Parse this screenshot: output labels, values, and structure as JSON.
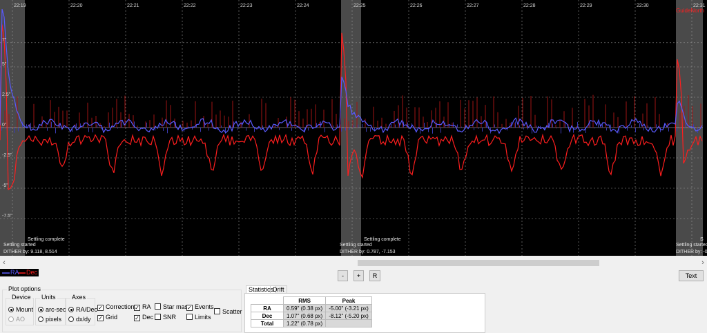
{
  "graph": {
    "time_labels": [
      "22:19",
      "22:20",
      "22:21",
      "22:22",
      "22:23",
      "22:24",
      "22:25",
      "22:26",
      "22:27",
      "22:28",
      "22:29",
      "22:30",
      "22:31"
    ],
    "y_labels": [
      "7\"",
      "5\"",
      "2.5\"",
      "0\"",
      "-2.5\"",
      "-5\"",
      "-7.5\""
    ],
    "corner_label": "GuideNorth",
    "events": [
      {
        "settling_started": "Settling started",
        "settling_complete": "Settling complete",
        "dither": "DITHER by: 9.118, 8.514"
      },
      {
        "settling_started": "Settling started",
        "settling_complete": "Settling complete",
        "dither": "DITHER by: 0.787, -7.153"
      },
      {
        "settling_started": "Settling started",
        "settling_complete": "S",
        "dither": "DITHER by: -0"
      }
    ],
    "colors": {
      "ra": "#5a5aff",
      "dec": "#ff1e1e",
      "corrections_ra": "#3c3cb4",
      "corrections_dec": "#a01414",
      "grid": "#9a9a9a",
      "settling_band": "#4a4a4a"
    }
  },
  "legend": {
    "ra": "RA",
    "dec": "Dec"
  },
  "buttons": {
    "minus": "-",
    "plus": "+",
    "reset": "R",
    "text": "Text"
  },
  "plot_options": {
    "title": "Plot options",
    "device": {
      "caption": "Device",
      "mount": "Mount",
      "ao": "AO",
      "selected": "Mount"
    },
    "units": {
      "caption": "Units",
      "arcsec": "arc-sec",
      "pixels": "pixels",
      "selected": "arc-sec"
    },
    "axes": {
      "caption": "Axes",
      "radec": "RA/Dec",
      "dxdy": "dx/dy",
      "selected": "RA/Dec"
    },
    "checks": {
      "corrections": "Corrections",
      "grid": "Grid",
      "ra": "RA",
      "dec": "Dec",
      "star_mass": "Star mass",
      "snr": "SNR",
      "events": "Events",
      "limits": "Limits",
      "scatter": "Scatter"
    }
  },
  "tabs": {
    "statistics": "Statistics",
    "drift": "Drift"
  },
  "stats": {
    "headers": [
      "",
      "RMS",
      "Peak"
    ],
    "rows": [
      {
        "label": "RA",
        "rms": "0.59\" (0.38 px)",
        "peak": "-5.00\" (-3.21 px)"
      },
      {
        "label": "Dec",
        "rms": "1.07\" (0.68 px)",
        "peak": "-8.12\" (-5.20 px)"
      },
      {
        "label": "Total",
        "rms": "1.22\" (0.78 px)",
        "peak": ""
      }
    ]
  }
}
